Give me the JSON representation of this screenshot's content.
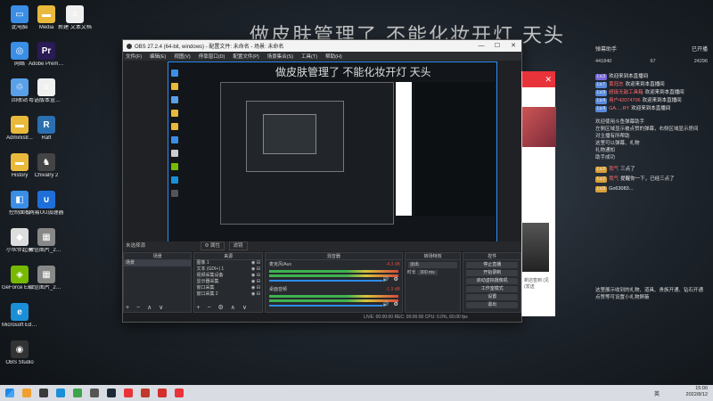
{
  "desktop": {
    "icons": [
      {
        "label": "此电脑",
        "glyph": "▭",
        "color": "#3a8ee6"
      },
      {
        "label": "Media",
        "glyph": "▬",
        "color": "#e8b93a"
      },
      {
        "label": "新建 文本文档",
        "glyph": "≡",
        "color": "#f0f0f0"
      },
      {
        "label": "网络",
        "glyph": "◎",
        "color": "#3a8ee6"
      },
      {
        "label": "Adobe Premie...",
        "glyph": "Pr",
        "color": "#2a1a55"
      },
      {
        "label": "回收站",
        "glyph": "♲",
        "color": "#5aa0e8"
      },
      {
        "label": "粤语版本宣讲字",
        "glyph": "≡",
        "color": "#f0f0f0"
      },
      {
        "label": "Administr...",
        "glyph": "▬",
        "color": "#e8b93a"
      },
      {
        "label": "Raft",
        "glyph": "R",
        "color": "#2a6fb0"
      },
      {
        "label": "History",
        "glyph": "▬",
        "color": "#e8b93a"
      },
      {
        "label": "Chivalry 2",
        "glyph": "♞",
        "color": "#444"
      },
      {
        "label": "控制面板",
        "glyph": "◧",
        "color": "#3a8ee6"
      },
      {
        "label": "网易UU加速器",
        "glyph": "∪",
        "color": "#1e6fd9"
      },
      {
        "label": "小伙伴起来",
        "glyph": "◆",
        "color": "#ddd"
      },
      {
        "label": "微信图片_2022081...",
        "glyph": "▦",
        "color": "#888"
      },
      {
        "label": "GeForce Experience",
        "glyph": "◈",
        "color": "#76b900"
      },
      {
        "label": "微信图片_2022081...",
        "glyph": "▦",
        "color": "#888"
      },
      {
        "label": "Microsoft Edge",
        "glyph": "e",
        "color": "#1a8fd8"
      },
      {
        "label": "OBS Studio",
        "glyph": "◉",
        "color": "#333"
      }
    ]
  },
  "banner_text": "做皮肤管理了 不能化妆开灯 天头",
  "obs": {
    "title": "OBS 27.2.4 (64-bit, windows) - 配置文件: 未命名 - 场景: 未命名",
    "menu": [
      "文件(F)",
      "编辑(E)",
      "视图(V)",
      "停靠窗口(D)",
      "配置文件(P)",
      "场景集合(S)",
      "工具(T)",
      "帮助(H)"
    ],
    "scene_bar_label": "未选择源",
    "scene_bar_buttons": [
      "⚙ 属性",
      "滤镜"
    ],
    "docks": {
      "scenes": {
        "title": "场景",
        "items": [
          "场景"
        ]
      },
      "sources": {
        "title": "来源",
        "items": [
          "图像 1",
          "文本 (GDI+) 1",
          "视频采集设备",
          "显示器采集",
          "窗口采集",
          "窗口采集 2"
        ]
      },
      "mixer": {
        "title": "混音器",
        "channels": [
          {
            "name": "麦克风/Aux",
            "db": "-4.3 dB"
          },
          {
            "name": "桌面音频",
            "db": "-1.9 dB"
          }
        ]
      },
      "transitions": {
        "title": "转场特效",
        "type": "淡出",
        "duration_label": "时长",
        "duration": "300 ms"
      },
      "controls": {
        "title": "控件",
        "buttons": [
          "停止直播",
          "开始录制",
          "启动虚拟摄像机",
          "工作室模式",
          "设置",
          "退出"
        ]
      }
    },
    "status": "LIVE: 00:00:00    REC: 00:00:00    CPU: 0.0%, 60.00 fps"
  },
  "pink_window": {
    "text": "新店签到 (见 (发送"
  },
  "chat": {
    "header_left": "弹幕助手",
    "header_right": "已开播",
    "stats": [
      "441840",
      "67",
      "24296"
    ],
    "messages": [
      {
        "tag": "Lv.3",
        "tag_color": "#7a6ad8",
        "user": "",
        "text": "欢迎来到本直播间"
      },
      {
        "tag": "Lv.7",
        "tag_color": "#5a8ad8",
        "user": "黄冠志",
        "text": "欢迎来到本直播间"
      },
      {
        "tag": "Lv.9",
        "tag_color": "#5a8ad8",
        "user": "超级无敌工具箱",
        "text": "欢迎来到本直播间"
      },
      {
        "tag": "Lv.4",
        "tag_color": "#5a8ad8",
        "user": "用户42074706",
        "text": "欢迎来到本直播间"
      },
      {
        "tag": "Lv.4",
        "tag_color": "#5a8ad8",
        "user": "GA.....RY",
        "text": "欢迎来到本直播间"
      }
    ],
    "notice": [
      "欢迎使用斗鱼弹幕助手",
      "左侧区域显示被点赞的弹幕，右侧区域显示房间",
      "对主播有所帮助",
      "这里可以弹幕、礼物",
      "礼物通知",
      "助手成功"
    ],
    "replies": [
      {
        "tag": "Lv.2",
        "user": "我气",
        "text": "三点了"
      },
      {
        "tag": "Lv.2",
        "user": "我气",
        "text": "提醒你一下，已经三点了"
      },
      {
        "tag": "Lv.8",
        "user": "",
        "text": "Go63083..."
      }
    ],
    "footer": [
      "这里展示收到的礼物、道具、贵族开通、钻石开通",
      "点赞等可设置小礼物屏蔽"
    ]
  },
  "taskbar": {
    "icons": [
      "#1e88e5",
      "#f0a030",
      "#3a3a3a",
      "#1a8fd8",
      "#3fa34d",
      "#555",
      "#1b2838",
      "#e8333b",
      "#c0392b",
      "#d32f2f",
      "#e8333b"
    ],
    "lang": "英",
    "time": "15:00",
    "date": "2022/8/12"
  }
}
